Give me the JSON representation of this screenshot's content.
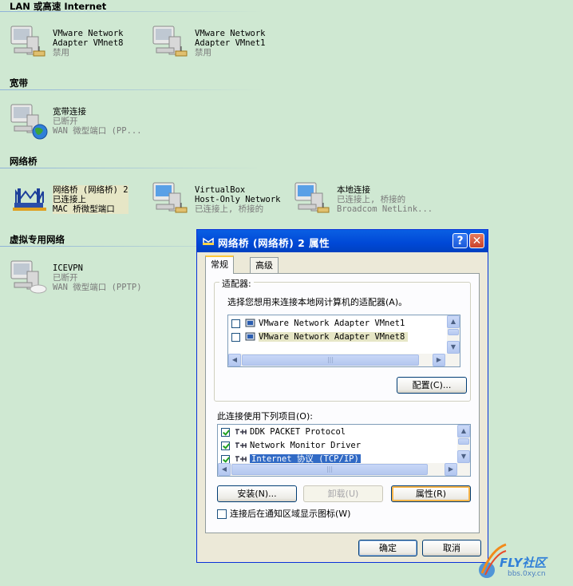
{
  "groups": {
    "lan": "LAN 或高速 Internet",
    "broadband": "宽带",
    "bridge": "网络桥",
    "vpn": "虚拟专用网络"
  },
  "connections": {
    "vmnet8": {
      "line1": "VMware Network",
      "line2": "Adapter VMnet8",
      "status": "禁用"
    },
    "vmnet1": {
      "line1": "VMware Network",
      "line2": "Adapter VMnet1",
      "status": "禁用"
    },
    "broadband": {
      "name": "宽带连接",
      "status": "已断开",
      "device": "WAN 微型端口 (PP..."
    },
    "bridge": {
      "name": "网络桥 (网络桥) 2",
      "status": "已连接上",
      "device": "MAC 桥微型端口"
    },
    "virtualbox": {
      "line1": "VirtualBox",
      "line2": "Host-Only Network",
      "status": "已连接上, 桥接的"
    },
    "local": {
      "name": "本地连接",
      "status": "已连接上, 桥接的",
      "device": "Broadcom NetLink..."
    },
    "icevpn": {
      "name": "ICEVPN",
      "status": "已断开",
      "device": "WAN 微型端口 (PPTP)"
    }
  },
  "dialog": {
    "title": "网络桥 (网络桥) 2 属性",
    "help": "?",
    "close": "✕",
    "tabs": [
      "常规",
      "高级"
    ],
    "adapters_legend": "适配器:",
    "adapters_desc": "选择您想用来连接本地网计算机的适配器(A)。",
    "adapters": [
      {
        "label": "VMware Network Adapter VMnet1",
        "checked": false
      },
      {
        "label": "VMware Network Adapter VMnet8",
        "checked": false
      }
    ],
    "configure_button": "配置(C)...",
    "items_label": "此连接使用下列项目(O):",
    "items": [
      {
        "label": "DDK PACKET Protocol",
        "checked": true
      },
      {
        "label": "Network Monitor Driver",
        "checked": true
      },
      {
        "label": "Internet 协议 (TCP/IP)",
        "checked": true
      }
    ],
    "install_button": "安装(N)...",
    "uninstall_button": "卸载(U)",
    "properties_button": "属性(R)",
    "notify_checkbox": "连接后在通知区域显示图标(W)",
    "ok_button": "确定",
    "cancel_button": "取消"
  },
  "watermark": {
    "brand": "FLY社区",
    "url": "bbs.0xy.cn"
  },
  "colors": {
    "desktop_bg": "#cfe8d2",
    "titlebar": "#0a5fe3",
    "selection": "#316ac5"
  }
}
